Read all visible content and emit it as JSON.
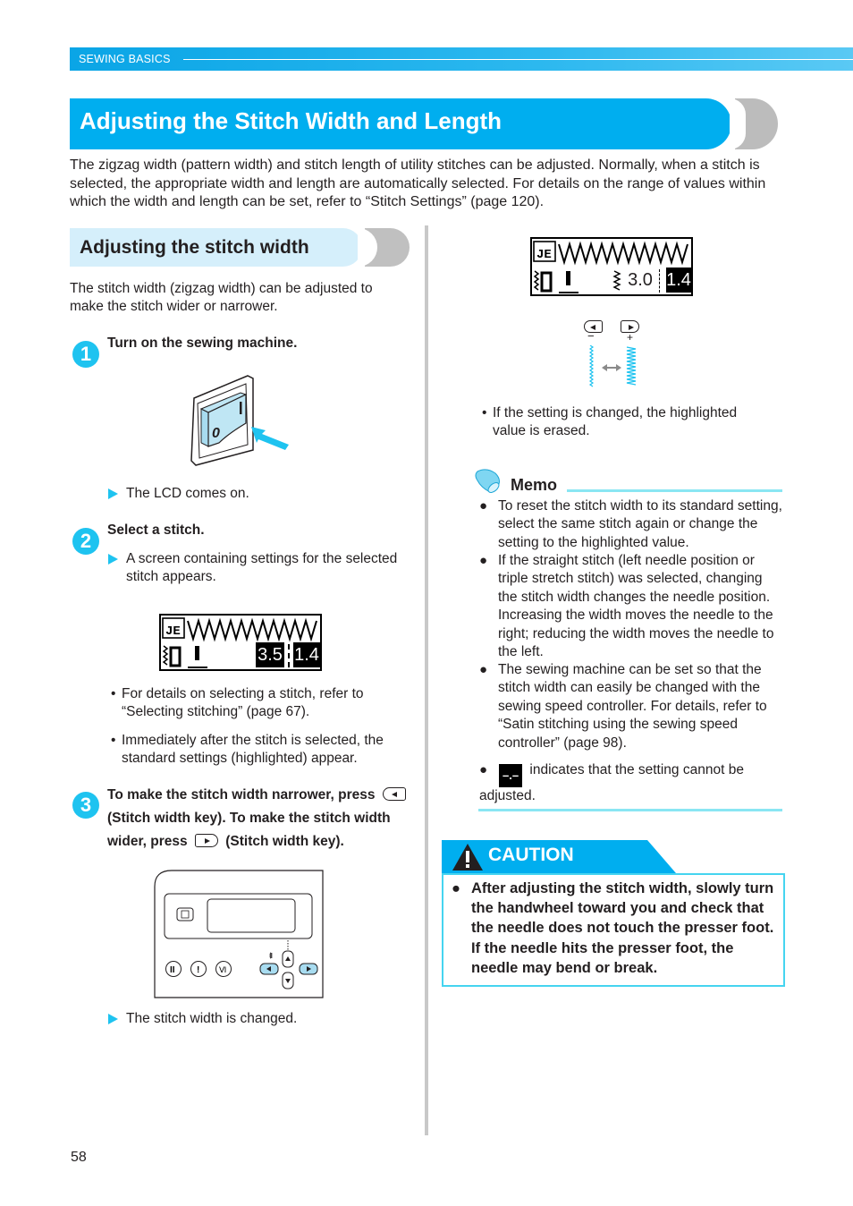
{
  "header": {
    "section_label": "SEWING BASICS"
  },
  "title": "Adjusting the Stitch Width and Length",
  "intro": "The zigzag width (pattern width) and stitch length of utility stitches can be adjusted. Normally, when a stitch is selected, the appropriate width and length are automatically selected. For details on the range of values within which the width and length can be set, refer to “Stitch Settings” (page 120).",
  "subheading": "Adjusting the stitch width",
  "sub_intro": "The stitch width (zigzag width) can be adjusted to make the stitch wider or narrower.",
  "steps": [
    {
      "number": "1",
      "title": "Turn on the sewing machine.",
      "illustration": {
        "switch_off_label": "0",
        "switch_on_label": "I"
      },
      "result": "The LCD comes on."
    },
    {
      "number": "2",
      "title": "Select a stitch.",
      "result": "A screen containing settings for the selected stitch appears.",
      "lcd": {
        "needle_value": "0",
        "width_value": "3.5",
        "length_value": "1.4",
        "width_highlighted": true,
        "length_highlighted": true
      },
      "notes": [
        "For details on selecting a stitch, refer to “Selecting stitching” (page 67).",
        "Immediately after the stitch is selected, the standard settings (highlighted) appear."
      ]
    },
    {
      "number": "3",
      "title_part1": "To make the stitch width narrower, press",
      "title_part2": "(Stitch width key). To make the stitch width",
      "title_part3": "wider, press",
      "title_part4": "(Stitch width key).",
      "result": "The stitch width is changed."
    }
  ],
  "right_column": {
    "lcd": {
      "needle_value": "0",
      "width_value": "3.0",
      "length_value": "1.4",
      "width_highlighted": false,
      "length_highlighted": true
    },
    "minus_label": "−",
    "plus_label": "+",
    "note": "If the setting is changed, the highlighted value is erased."
  },
  "memo": {
    "title": "Memo",
    "items": [
      "To reset the stitch width to its standard setting, select the same stitch again or change the setting to the highlighted value.",
      "If the straight stitch (left needle position or triple stretch stitch) was selected, changing the stitch width changes the needle position. Increasing the width moves the needle to the right; reducing the width moves the needle to the left.",
      "The sewing machine can be set so that the stitch width can easily be changed with the sewing speed controller. For details, refer to “Satin stitching using the sewing speed controller” (page 98).",
      "indicates that the setting cannot be adjusted."
    ],
    "disabled_indicator": "–.–"
  },
  "caution": {
    "label": "CAUTION",
    "text": "After adjusting the stitch width, slowly turn the handwheel toward you and check that the needle does not touch the presser foot. If the needle hits the presser foot, the needle may bend or break."
  },
  "bullet_glyph": "•",
  "memo_bullet_glyph": "●",
  "page_number": "58",
  "colors": {
    "accent": "#00aeef",
    "light_accent": "#d5effb",
    "memo_rule": "#8ae6f3",
    "gray_cap": "#bcbcbc"
  }
}
